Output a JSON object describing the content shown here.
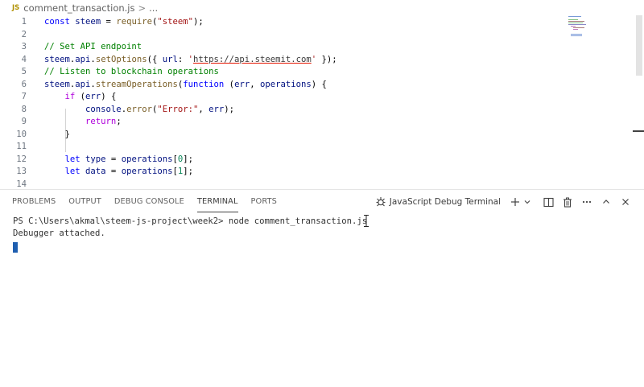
{
  "breadcrumb": {
    "file_badge": "JS",
    "file_name": "comment_transaction.js",
    "separator": ">",
    "more": "..."
  },
  "editor": {
    "lines": [
      {
        "num": "1",
        "tokens": [
          [
            "kw",
            "const "
          ],
          [
            "var",
            "steem"
          ],
          [
            "plain",
            " = "
          ],
          [
            "fn",
            "require"
          ],
          [
            "plain",
            "("
          ],
          [
            "str",
            "\"steem\""
          ],
          [
            "plain",
            ");"
          ]
        ]
      },
      {
        "num": "2",
        "tokens": []
      },
      {
        "num": "3",
        "tokens": [
          [
            "cm",
            "// Set API endpoint"
          ]
        ]
      },
      {
        "num": "4",
        "tokens": [
          [
            "var",
            "steem"
          ],
          [
            "plain",
            "."
          ],
          [
            "var",
            "api"
          ],
          [
            "plain",
            "."
          ],
          [
            "fn",
            "setOptions"
          ],
          [
            "plain",
            "({ "
          ],
          [
            "var",
            "url"
          ],
          [
            "plain",
            ": "
          ],
          [
            "str",
            "'"
          ],
          [
            "url",
            "https://api.steemit.com"
          ],
          [
            "str",
            "'"
          ],
          [
            "plain",
            " });"
          ]
        ]
      },
      {
        "num": "5",
        "tokens": [
          [
            "cm",
            "// Listen to blockchain operations"
          ]
        ]
      },
      {
        "num": "6",
        "tokens": [
          [
            "var",
            "steem"
          ],
          [
            "plain",
            "."
          ],
          [
            "var",
            "api"
          ],
          [
            "plain",
            "."
          ],
          [
            "fn",
            "streamOperations"
          ],
          [
            "plain",
            "("
          ],
          [
            "kw",
            "function"
          ],
          [
            "plain",
            " ("
          ],
          [
            "var",
            "err"
          ],
          [
            "plain",
            ", "
          ],
          [
            "var",
            "operations"
          ],
          [
            "plain",
            ") {"
          ]
        ]
      },
      {
        "num": "7",
        "tokens": [
          [
            "plain",
            "    "
          ],
          [
            "ctl",
            "if"
          ],
          [
            "plain",
            " ("
          ],
          [
            "var",
            "err"
          ],
          [
            "plain",
            ") {"
          ]
        ]
      },
      {
        "num": "8",
        "tokens": [
          [
            "plain",
            "        "
          ],
          [
            "var",
            "console"
          ],
          [
            "plain",
            "."
          ],
          [
            "fn",
            "error"
          ],
          [
            "plain",
            "("
          ],
          [
            "str",
            "\"Error:\""
          ],
          [
            "plain",
            ", "
          ],
          [
            "var",
            "err"
          ],
          [
            "plain",
            ");"
          ]
        ]
      },
      {
        "num": "9",
        "tokens": [
          [
            "plain",
            "        "
          ],
          [
            "ctl",
            "return"
          ],
          [
            "plain",
            ";"
          ]
        ]
      },
      {
        "num": "10",
        "tokens": [
          [
            "plain",
            "    }"
          ]
        ]
      },
      {
        "num": "11",
        "tokens": []
      },
      {
        "num": "12",
        "tokens": [
          [
            "plain",
            "    "
          ],
          [
            "kw",
            "let "
          ],
          [
            "var",
            "type"
          ],
          [
            "plain",
            " = "
          ],
          [
            "var",
            "operations"
          ],
          [
            "plain",
            "["
          ],
          [
            "num",
            "0"
          ],
          [
            "plain",
            "];"
          ]
        ]
      },
      {
        "num": "13",
        "tokens": [
          [
            "plain",
            "    "
          ],
          [
            "kw",
            "let "
          ],
          [
            "var",
            "data"
          ],
          [
            "plain",
            " = "
          ],
          [
            "var",
            "operations"
          ],
          [
            "plain",
            "["
          ],
          [
            "num",
            "1"
          ],
          [
            "plain",
            "];"
          ]
        ]
      },
      {
        "num": "14",
        "tokens": []
      }
    ]
  },
  "panel": {
    "tabs": [
      {
        "label": "PROBLEMS",
        "active": false
      },
      {
        "label": "OUTPUT",
        "active": false
      },
      {
        "label": "DEBUG CONSOLE",
        "active": false
      },
      {
        "label": "TERMINAL",
        "active": true
      },
      {
        "label": "PORTS",
        "active": false
      }
    ],
    "terminal_label": "JavaScript Debug Terminal",
    "actions": [
      "new-terminal-icon",
      "split-terminal-icon",
      "trash-icon",
      "more-icon",
      "maximize-icon",
      "close-icon"
    ]
  },
  "terminal": {
    "lines": [
      "PS C:\\Users\\akmal\\steem-js-project\\week2> node comment_transaction.js",
      "Debugger attached."
    ]
  },
  "colors": {
    "keyword": "#0000ff",
    "control": "#af00db",
    "function": "#795e26",
    "variable": "#001080",
    "string": "#a31515",
    "comment": "#008000",
    "number": "#098658",
    "cursor": "#1f5fb0"
  }
}
